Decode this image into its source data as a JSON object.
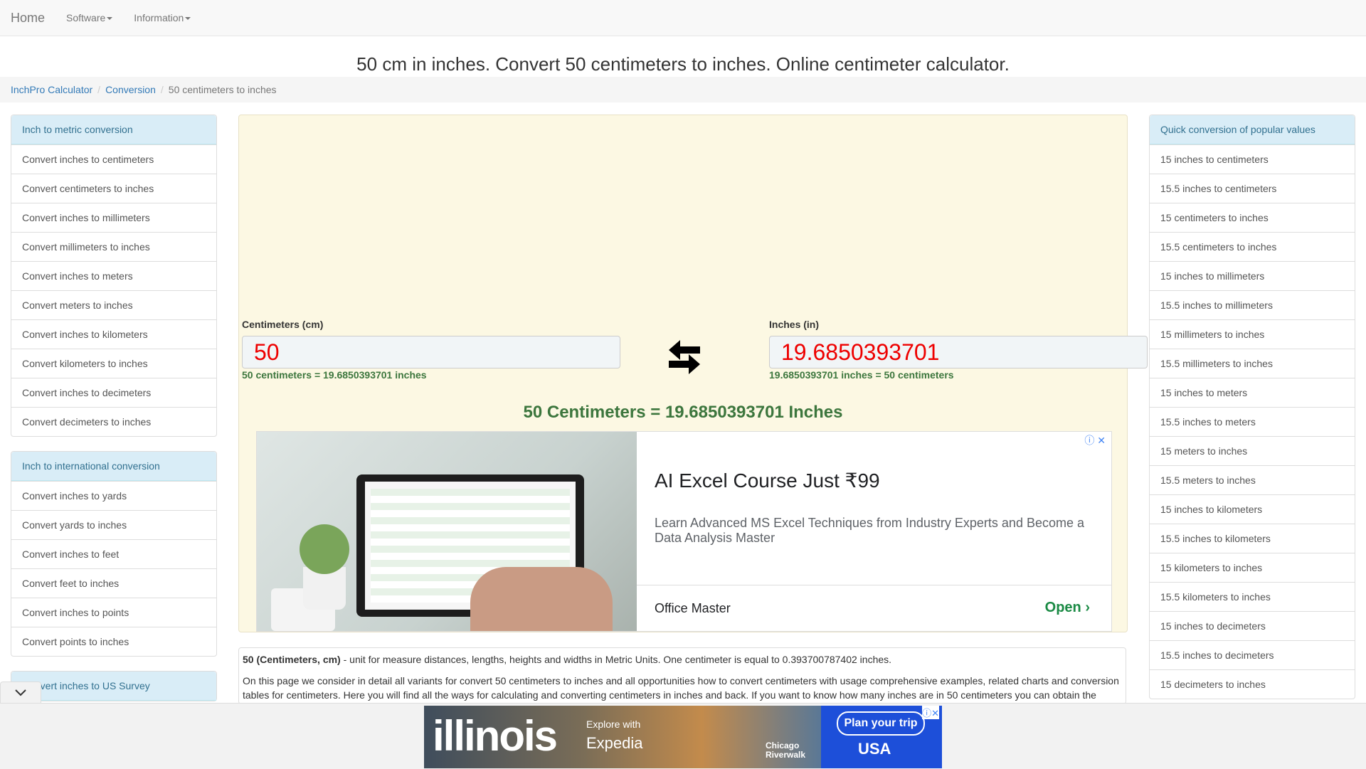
{
  "nav": {
    "home": "Home",
    "menus": [
      "Software",
      "Information"
    ]
  },
  "page_title": "50 cm in inches. Convert 50 centimeters to inches. Online centimeter calculator.",
  "breadcrumb": [
    "InchPro Calculator",
    "Conversion",
    "50 centimeters to inches"
  ],
  "left_groups": [
    {
      "heading": "Inch to metric conversion",
      "items": [
        "Convert inches to centimeters",
        "Convert centimeters to inches",
        "Convert inches to millimeters",
        "Convert millimeters to inches",
        "Convert inches to meters",
        "Convert meters to inches",
        "Convert inches to kilometers",
        "Convert kilometers to inches",
        "Convert inches to decimeters",
        "Convert decimeters to inches"
      ]
    },
    {
      "heading": "Inch to international conversion",
      "items": [
        "Convert inches to yards",
        "Convert yards to inches",
        "Convert inches to feet",
        "Convert feet to inches",
        "Convert inches to points",
        "Convert points to inches"
      ]
    },
    {
      "heading": "Convert inches to US Survey",
      "items": []
    }
  ],
  "calculator": {
    "from_label": "Centimeters (cm)",
    "from_value": "50",
    "from_eq": "50 centimeters = 19.6850393701 inches",
    "to_label": "Inches (in)",
    "to_value": "19.6850393701",
    "to_eq": "19.6850393701 inches = 50 centimeters",
    "result": "50 Centimeters = 19.6850393701 Inches"
  },
  "ad": {
    "title": "AI Excel Course Just ₹99",
    "description": "Learn Advanced MS Excel Techniques from Industry Experts and Become a Data Analysis Master",
    "brand": "Office Master",
    "cta": "Open",
    "info": "ⓘ ✕"
  },
  "description": {
    "bold": "50 (Centimeters, cm)",
    "p1_rest": " - unit for measure distances, lengths, heights and widths in Metric Units. One centimeter is equal to 0.393700787402 inches.",
    "p2": "On this page we consider in detail all variants for convert 50 centimeters to inches and all opportunities how to convert centimeters with usage comprehensive examples, related charts and conversion tables for centimeters. Here you will find all the ways for calculating and converting centimeters in inches and back. If you want to know how many inches are in 50 centimeters you can obtain the"
  },
  "right_group": {
    "heading": "Quick conversion of popular values",
    "items": [
      "15 inches to centimeters",
      "15.5 inches to centimeters",
      "15 centimeters to inches",
      "15.5 centimeters to inches",
      "15 inches to millimeters",
      "15.5 inches to millimeters",
      "15 millimeters to inches",
      "15.5 millimeters to inches",
      "15 inches to meters",
      "15.5 inches to meters",
      "15 meters to inches",
      "15.5 meters to inches",
      "15 inches to kilometers",
      "15.5 inches to kilometers",
      "15 kilometers to inches",
      "15.5 kilometers to inches",
      "15 inches to decimeters",
      "15.5 inches to decimeters",
      "15 decimeters to inches"
    ]
  },
  "bottom_ad": {
    "logo": "illinois",
    "explore": "Explore with",
    "expedia": "Expedia",
    "chicago": "Chicago Riverwalk",
    "plan": "Plan your trip",
    "usa": "USA",
    "close": "ⓘ✕"
  }
}
